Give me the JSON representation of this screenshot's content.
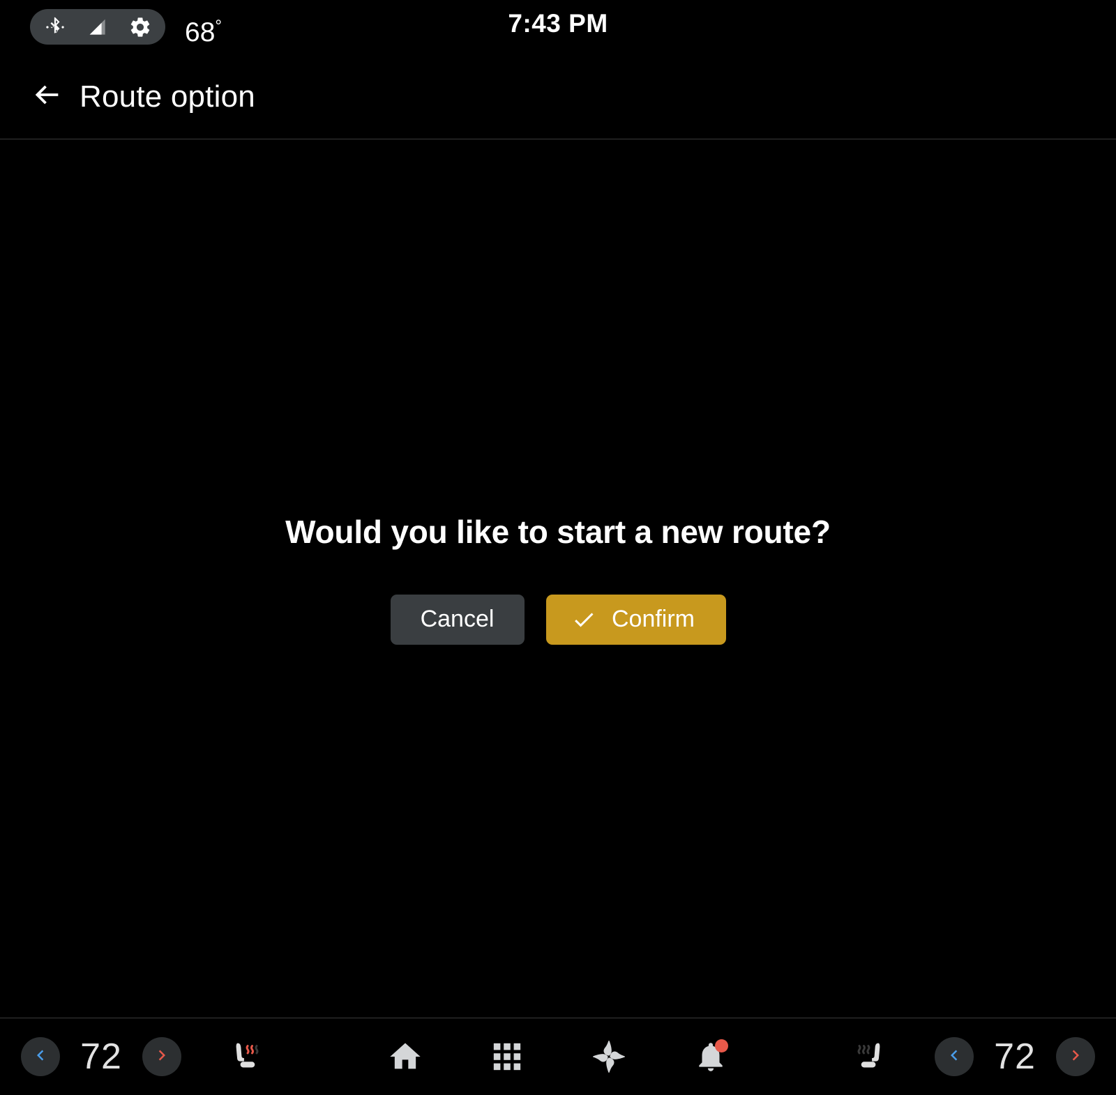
{
  "status_bar": {
    "icons": [
      {
        "name": "bluetooth-icon",
        "label": "Bluetooth"
      },
      {
        "name": "signal-icon",
        "label": "Cellular signal"
      },
      {
        "name": "gear-icon",
        "label": "Settings"
      }
    ],
    "temperature": "68",
    "degree_symbol": "°",
    "clock": "7:43 PM"
  },
  "header": {
    "back_icon": "arrow-left-icon",
    "title": "Route option"
  },
  "dialog": {
    "message": "Would you like to start a new route?",
    "cancel_label": "Cancel",
    "confirm_label": "Confirm",
    "confirm_icon": "check-icon"
  },
  "bottom_bar": {
    "left_climate": {
      "decrease_icon": "chevron-left-icon",
      "temperature": "72",
      "increase_icon": "chevron-right-icon",
      "seat_heater_icon": "heated-seat-icon",
      "seat_heater_level": "2"
    },
    "right_climate": {
      "seat_heater_icon": "heated-seat-icon",
      "seat_heater_level": "0",
      "decrease_icon": "chevron-left-icon",
      "temperature": "72",
      "increase_icon": "chevron-right-icon"
    },
    "nav_items": [
      {
        "name": "home-icon",
        "label": "Home"
      },
      {
        "name": "apps-grid-icon",
        "label": "Apps"
      },
      {
        "name": "fan-icon",
        "label": "Climate"
      },
      {
        "name": "notifications-bell-icon",
        "label": "Notifications"
      }
    ]
  },
  "colors": {
    "background": "#000000",
    "confirm_accent": "#c8991e",
    "cancel_surface": "#3a3e41",
    "status_pill": "#3c4043",
    "chevron_cool": "#4a9eeb",
    "chevron_heat": "#e8594a",
    "badge": "#e8594a",
    "divider": "#3a3a3a"
  }
}
